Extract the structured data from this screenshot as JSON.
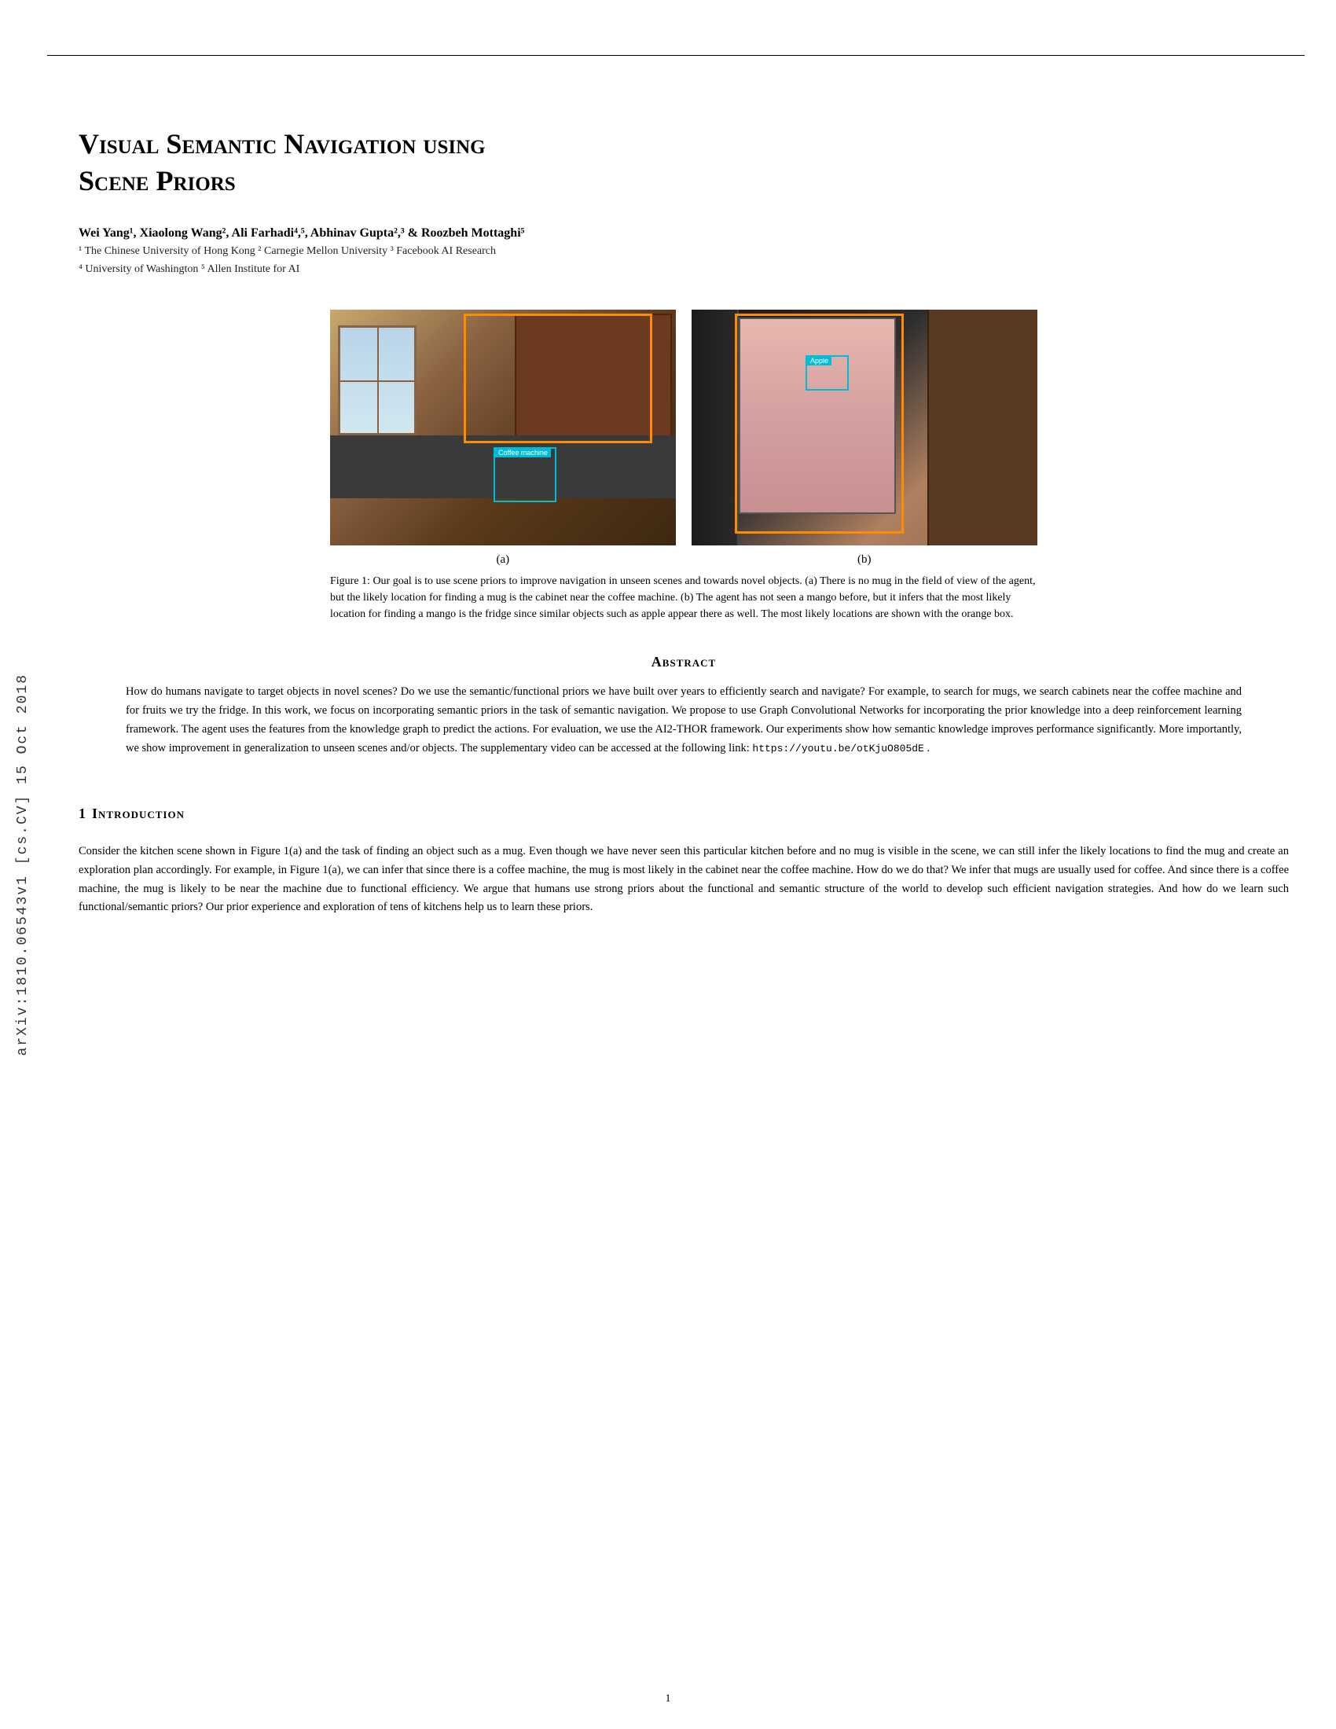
{
  "sidebar": {
    "text": "arXiv:1810.06543v1  [cs.CV]  15 Oct 2018"
  },
  "top_rule": true,
  "title": "Visual Semantic Navigation using\nScene Priors",
  "authors": {
    "line": "Wei Yang¹, Xiaolong Wang², Ali Farhadi⁴,⁵, Abhinav Gupta²,³ & Roozbeh Mottaghi⁵",
    "affiliations": [
      "¹ The Chinese University of Hong Kong  ² Carnegie Mellon University  ³ Facebook AI Research",
      "⁴ University of Washington  ⁵ Allen Institute for AI"
    ]
  },
  "figure": {
    "sub_a_label": "(a)",
    "sub_b_label": "(b)",
    "coffee_machine_label": "Coffee machine",
    "apple_label": "Apple",
    "caption": "Figure 1: Our goal is to use scene priors to improve navigation in unseen scenes and towards novel objects. (a) There is no mug in the field of view of the agent, but the likely location for finding a mug is the cabinet near the coffee machine. (b) The agent has not seen a mango before, but it infers that the most likely location for finding a mango is the fridge since similar objects such as apple appear there as well. The most likely locations are shown with the orange box."
  },
  "abstract": {
    "section_title": "Abstract",
    "text": "How do humans navigate to target objects in novel scenes? Do we use the semantic/functional priors we have built over years to efficiently search and navigate? For example, to search for mugs, we search cabinets near the coffee machine and for fruits we try the fridge. In this work, we focus on incorporating semantic priors in the task of semantic navigation. We propose to use Graph Convolutional Networks for incorporating the prior knowledge into a deep reinforcement learning framework. The agent uses the features from the knowledge graph to predict the actions. For evaluation, we use the AI2-THOR framework. Our experiments show how semantic knowledge improves performance significantly. More importantly, we show improvement in generalization to unseen scenes and/or objects. The supplementary video can be accessed at the following link: ",
    "link": "https://youtu.be/otKjuO805dE",
    "link_end": " ."
  },
  "section1": {
    "number": "1",
    "title": "Introduction",
    "paragraphs": [
      "Consider the kitchen scene shown in Figure 1(a) and the task of finding an object such as a mug. Even though we have never seen this particular kitchen before and no mug is visible in the scene, we can still infer the likely locations to find the mug and create an exploration plan accordingly. For example, in Figure 1(a), we can infer that since there is a coffee machine, the mug is most likely in the cabinet near the coffee machine. How do we do that? We infer that mugs are usually used for coffee. And since there is a coffee machine, the mug is likely to be near the machine due to functional efficiency. We argue that humans use strong priors about the functional and semantic structure of the world to develop such efficient navigation strategies. And how do we learn such functional/semantic priors? Our prior experience and exploration of tens of kitchens help us to learn these priors."
    ]
  },
  "page_number": "1"
}
